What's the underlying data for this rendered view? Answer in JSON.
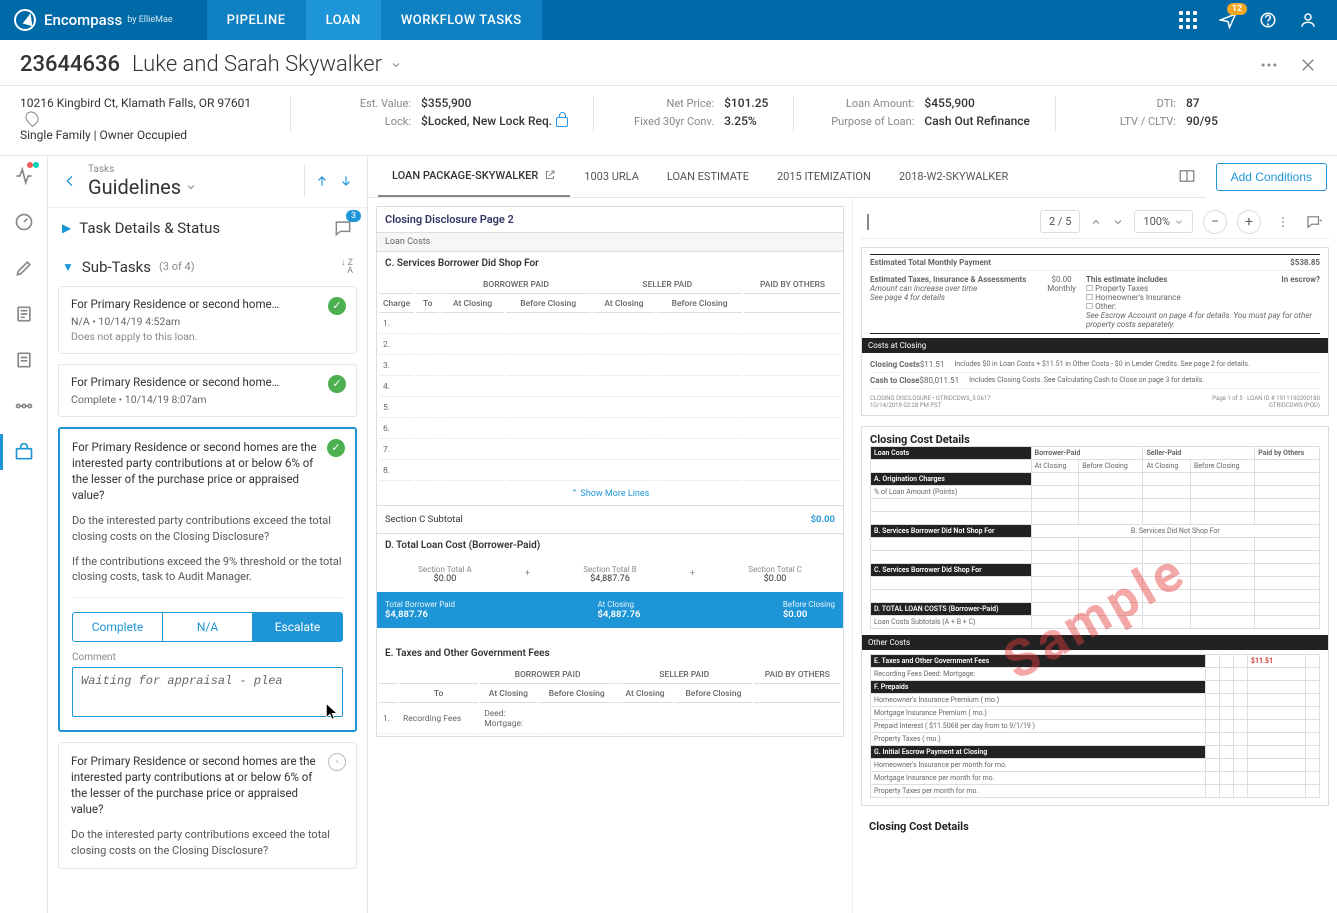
{
  "brand": {
    "name": "Encompass",
    "by_prefix": "by",
    "by": "EllieMae"
  },
  "nav": {
    "tabs": [
      "PIPELINE",
      "LOAN",
      "WORKFLOW TASKS"
    ],
    "active": 1,
    "notif_badge": "12"
  },
  "loan": {
    "number": "23644636",
    "name": "Luke and Sarah Skywalker",
    "address": "10216 Kingbird Ct, Klamath Falls, OR 97601",
    "prop_type": "Single Family | Owner Occupied"
  },
  "summary": {
    "est_value_lbl": "Est. Value:",
    "est_value": "$355,900",
    "lock_lbl": "Lock:",
    "lock": "$Locked, New Lock Req.",
    "net_price_lbl": "Net Price:",
    "net_price": "$101.25",
    "rate_lbl": "Fixed 30yr Conv.",
    "rate": "3.25%",
    "loan_amt_lbl": "Loan Amount:",
    "loan_amt": "$455,900",
    "purpose_lbl": "Purpose of Loan:",
    "purpose": "Cash Out Refinance",
    "dti_lbl": "DTI:",
    "dti": "87",
    "ltv_lbl": "LTV / CLTV:",
    "ltv": "90/95"
  },
  "tasks_head": {
    "crumb": "Tasks",
    "title": "Guidelines",
    "add_btn": "Add Conditions"
  },
  "sections": {
    "details": "Task Details & Status",
    "details_badge": "3",
    "sub": "Sub-Tasks",
    "sub_count": "(3 of 4)"
  },
  "subtasks": [
    {
      "title": "For Primary Residence or second home…",
      "meta": "N/A  •  10/14/19  4:52am",
      "note": "Does not apply to this loan.",
      "status": "done"
    },
    {
      "title": "For Primary Residence or second home…",
      "meta": "Complete  •  10/14/19  8:07am",
      "status": "done"
    },
    {
      "title": "For Primary Residence or second homes are the interested party contributions at or below 6% of the lesser of the purchase price or appraised value?",
      "p2": "Do the interested party contributions exceed the total closing costs on the Closing Disclosure?",
      "p3": "If the contributions exceed the 9% threshold or the total closing costs, task to Audit Manager.",
      "status": "done",
      "selected": true,
      "actions": [
        "Complete",
        "N/A",
        "Escalate"
      ],
      "action_active": 2,
      "comment_lbl": "Comment",
      "comment_val": "Waiting for appraisal - plea"
    },
    {
      "title": "For Primary Residence or second homes are the interested party contributions at or below 6% of the lesser of the purchase price or appraised value?",
      "p2": "Do the interested party contributions exceed the total closing costs on the Closing Disclosure?",
      "status": "pending"
    }
  ],
  "doc_tabs": [
    "LOAN PACKAGE-SKYWALKER",
    "1003 URLA",
    "LOAN ESTIMATE",
    "2015 ITEMIZATION",
    "2018-W2-SKYWALKER"
  ],
  "doc_tab_active": 0,
  "cd": {
    "page_title": "Closing Disclosure Page 2",
    "loan_costs": "Loan Costs",
    "sect_c": "C. Services Borrower Did Shop For",
    "cols": {
      "charge": "Charge",
      "to": "To",
      "borrower": "BORROWER PAID",
      "seller": "SELLER PAID",
      "others": "PAID BY OTHERS",
      "at": "At Closing",
      "before": "Before Closing"
    },
    "rows": [
      "1.",
      "2.",
      "3.",
      "4.",
      "5.",
      "6.",
      "7.",
      "8."
    ],
    "show_more": "Show More Lines",
    "subtotal_lbl": "Section C Subtotal",
    "subtotal_val": "$0.00",
    "sect_d": "D. Total Loan Cost (Borrower-Paid)",
    "tot_a_lbl": "Section Total A",
    "tot_a": "$0.00",
    "tot_b_lbl": "Section Total B",
    "tot_b": "$4,887.76",
    "tot_c_lbl": "Section Total C",
    "tot_c": "$0.00",
    "blue_l1": "Total Borrower Paid",
    "blue_v1": "$4,887.76",
    "blue_l2": "At Closing",
    "blue_v2": "$4,887.76",
    "blue_l3": "Before Closing",
    "blue_v3": "$0.00",
    "sect_e": "E. Taxes and Other Government Fees",
    "rec_fee": "Recording Fees",
    "deed": "Deed:",
    "mortgage": "Mortgage:"
  },
  "pdf": {
    "page": "2 / 5",
    "zoom": "100%"
  },
  "thumb1": {
    "emp_lbl": "Estimated Total Monthly Payment",
    "emp_val": "$538.85",
    "inc_lbl": "This estimate includes",
    "escrow_lbl": "In escrow?",
    "inc_items": [
      "Property Taxes",
      "Homeowner's Insurance",
      "Other:"
    ],
    "eti_lbl": "Estimated Taxes, Insurance & Assessments",
    "eti_val": "$0.00",
    "eti_freq": "Monthly",
    "eti_note1": "Amount can increase over time",
    "eti_note2": "See page 4 for details",
    "eti_note3": "See Escrow Account on page 4 for details. You must pay for other property costs separately.",
    "costs_bar": "Costs at Closing",
    "cc_lbl": "Closing Costs",
    "cc_val": "$11.51",
    "cc_note": "Includes $0 in Loan Costs + $11.51 in Other Costs - $0 in Lender Credits. See page 2 for details.",
    "ctc_lbl": "Cash to Close",
    "ctc_val": "$80,011.51",
    "ctc_note": "Includes Closing Costs. See Calculating Cash to Close on page 3 for details.",
    "footer_l": "CLOSING DISCLOSURE • GTRIDCDWS_5  0617",
    "footer_d": "10/14/2019 02:28 PM PST",
    "footer_r1": "Page 1 of 5 · LOAN ID # 1911190200180",
    "footer_r2": "GTRIDCDWS (POD)"
  },
  "thumb2": {
    "title": "Closing Cost Details",
    "watermark": "Sample",
    "loan_costs": "Loan Costs",
    "cols": [
      "",
      "Borrower-Paid",
      "Seller-Paid",
      "Paid by Others"
    ],
    "subcols": [
      "At Closing",
      "Before Closing",
      "At Closing",
      "Before Closing",
      ""
    ],
    "sections": [
      "A. Origination Charges",
      "% of Loan Amount (Points)",
      "B. Services Borrower Did Not Shop For",
      "B. Services Did Not Shop For",
      "C. Services Borrower Did Shop For",
      "D. TOTAL LOAN COSTS (Borrower-Paid)",
      "Loan Costs Subtotals (A + B + C)"
    ],
    "other_bar": "Other Costs",
    "other_sections": [
      "E. Taxes and Other Government Fees",
      "Recording Fees          Deed:          Mortgage:",
      "F. Prepaids",
      "Homeowner's Insurance Premium (  mo.)",
      "Mortgage Insurance Premium (  mo.)",
      "Prepaid Interest ( $11.5068 per day from     to 9/1/19 )",
      "Property Taxes (  mo.)",
      "G. Initial Escrow Payment at Closing",
      "Homeowner's Insurance       per month for    mo.",
      "Mortgage Insurance            per month for    mo.",
      "Property Taxes                     per month for    mo."
    ],
    "val_1151": "$11.51",
    "footer_title": "Closing Cost Details"
  }
}
